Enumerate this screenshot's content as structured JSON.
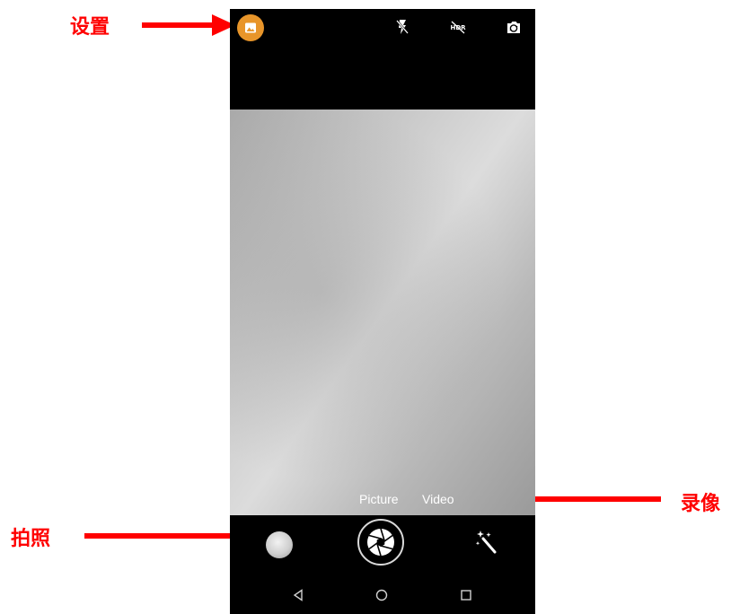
{
  "annotations": {
    "settings": "设置",
    "take_photo": "拍照",
    "record_video": "录像"
  },
  "camera": {
    "top_bar": {
      "gallery_icon": "image-icon",
      "flash_icon": "flash-off-icon",
      "hdr_icon": "hdr-off-icon",
      "switch_camera_icon": "camera-switch-icon",
      "accent_color": "#e8952a"
    },
    "modes": {
      "picture_label": "Picture",
      "video_label": "Video"
    },
    "controls": {
      "thumbnail_icon": "last-photo-thumbnail",
      "shutter_icon": "shutter-icon",
      "effects_icon": "magic-wand-icon"
    }
  },
  "navigation": {
    "back_icon": "back-triangle-icon",
    "home_icon": "home-circle-icon",
    "recent_icon": "recent-square-icon"
  },
  "colors": {
    "annotation": "#ff0000"
  }
}
